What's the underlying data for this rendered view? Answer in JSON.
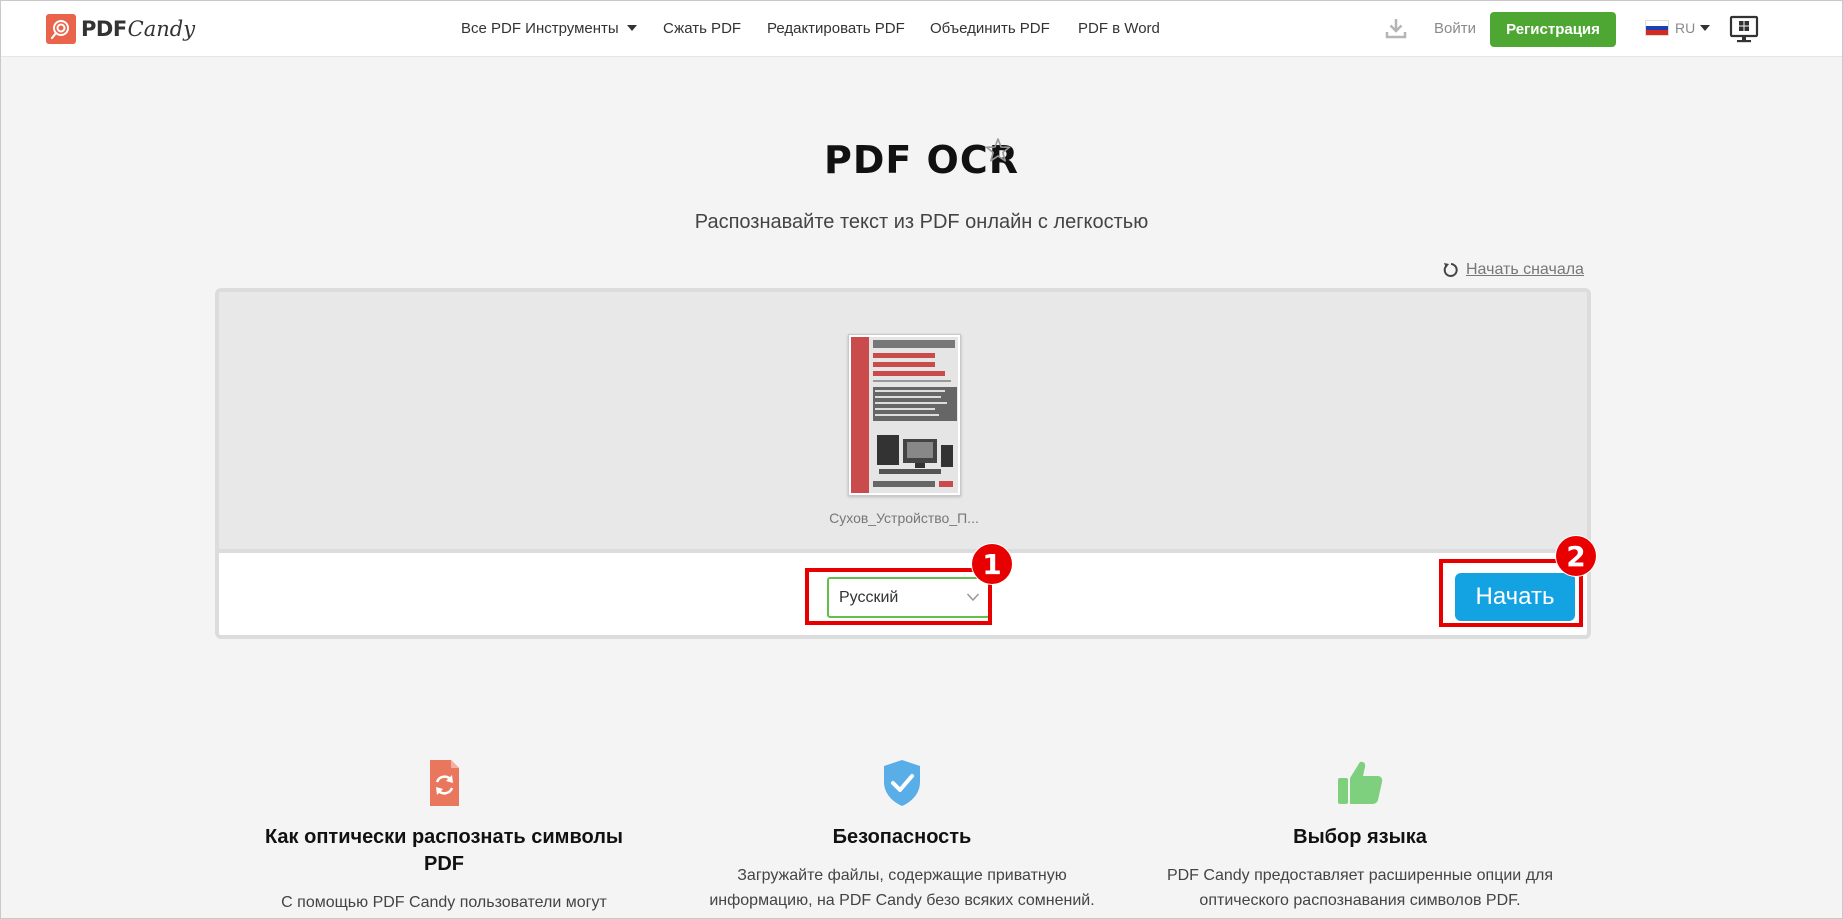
{
  "header": {
    "logo_pdf": "PDF",
    "logo_candy": "Candy",
    "nav": {
      "all_tools": "Все PDF Инструменты",
      "compress": "Сжать PDF",
      "edit": "Редактировать PDF",
      "merge": "Объединить PDF",
      "to_word": "PDF в Word"
    },
    "login": "Войти",
    "signup": "Регистрация",
    "lang": "RU"
  },
  "page": {
    "title": "PDF OCR",
    "subtitle": "Распознавайте текст из PDF онлайн с легкостью",
    "restart": "Начать сначала"
  },
  "upload": {
    "filename": "Сухов_Устройство_П...",
    "language_selected": "Русский",
    "start_button": "Начать"
  },
  "annotations": {
    "badge1": "1",
    "badge2": "2"
  },
  "features": [
    {
      "title": "Как оптически распознать символы PDF",
      "text": "С помощью PDF Candy пользователи могут"
    },
    {
      "title": "Безопасность",
      "text": "Загружайте файлы, содержащие приватную информацию, на PDF Candy безо всяких сомнений."
    },
    {
      "title": "Выбор языка",
      "text": "PDF Candy предоставляет расширенные опции для оптического распознавания символов PDF."
    }
  ],
  "colors": {
    "brand": "#e9644b",
    "signup_green": "#4ea733",
    "start_blue": "#13a3e3",
    "select_border": "#63bf4a",
    "annotation_red": "#e80000"
  }
}
